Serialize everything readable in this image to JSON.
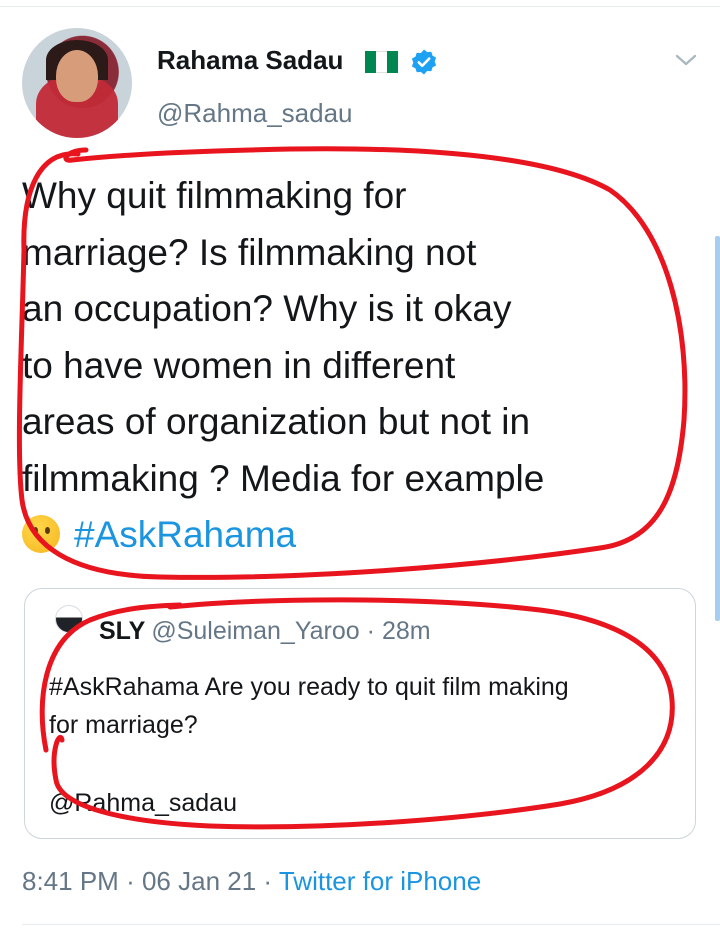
{
  "author": {
    "display_name": "Rahama Sadau",
    "handle": "@Rahma_sadau",
    "flag_icon": "nigeria-flag-icon",
    "verified_icon": "verified-badge-icon"
  },
  "tweet": {
    "lines": [
      "Why quit filmmaking for",
      "marriage? Is filmmaking not",
      "an occupation? Why is it okay",
      "to have women in different",
      "areas of organization but not in",
      "filmmaking ? Media for example"
    ],
    "emoji": "thinking-face-emoji",
    "hashtag": "#AskRahama"
  },
  "quoted_tweet": {
    "name": "SLY",
    "handle": "@Suleiman_Yaroo",
    "separator": "·",
    "time": "28m",
    "body_lines": [
      "#AskRahama Are you ready to quit film making",
      "for marriage?"
    ],
    "mention": "@Rahma_sadau"
  },
  "meta": {
    "time": "8:41 PM",
    "separator1": "·",
    "date": "06 Jan 21",
    "separator2": "·",
    "source": "Twitter for iPhone"
  },
  "colors": {
    "link_blue": "#1b95e0",
    "secondary_text": "#657786",
    "annotation_red": "#e8141e",
    "flag_green": "#008751"
  }
}
